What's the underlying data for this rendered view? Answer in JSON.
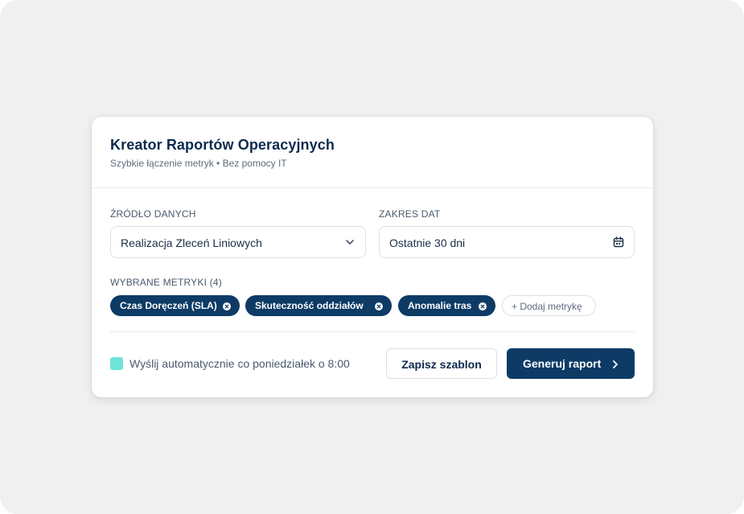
{
  "header": {
    "title": "Kreator Raportów Operacyjnych",
    "subtitle": "Szybkie łączenie metryk • Bez pomocy IT"
  },
  "source": {
    "label": "ŹRÓDŁO DANYCH",
    "value": "Realizacja Zleceń Liniowych",
    "icon": "chevron-down-icon"
  },
  "date_range": {
    "label": "ZAKRES DAT",
    "value": "Ostatnie 30 dni",
    "icon": "calendar-icon"
  },
  "metrics": {
    "label": "WYBRANE METRYKI (4)",
    "chips": [
      {
        "label": "Czas Doręczeń (SLA)"
      },
      {
        "label": "Skuteczność oddziałów"
      },
      {
        "label": "Anomalie tras"
      }
    ],
    "add_label": "+ Dodaj metrykę"
  },
  "schedule": {
    "label": "Wyślij automatycznie co poniedziałek o 8:00",
    "checked": true
  },
  "actions": {
    "save_label": "Zapisz szablon",
    "generate_label": "Generuj raport"
  },
  "colors": {
    "primary": "#0d3b66",
    "accent_check": "#6fe3d6",
    "background": "#f0f0f0"
  }
}
